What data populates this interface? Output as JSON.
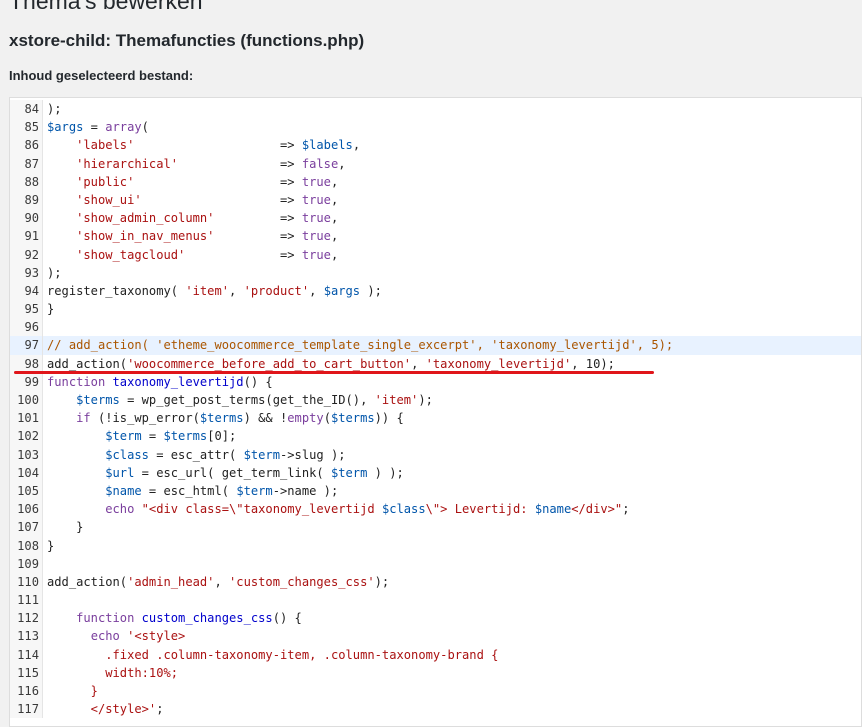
{
  "header": {
    "page_title": "Thema's bewerken",
    "file_title": "xstore-child: Themafuncties (functions.php)",
    "content_label": "Inhoud geselecteerd bestand:"
  },
  "editor": {
    "active_line": 97,
    "highlighted_line": 98,
    "lines": [
      {
        "num": "84",
        "segments": [
          {
            "t": ");",
            "c": "plain"
          }
        ]
      },
      {
        "num": "85",
        "segments": [
          {
            "t": "$args",
            "c": "var"
          },
          {
            "t": " = ",
            "c": "plain"
          },
          {
            "t": "array",
            "c": "kw"
          },
          {
            "t": "(",
            "c": "plain"
          }
        ]
      },
      {
        "num": "86",
        "segments": [
          {
            "t": "    'labels'",
            "c": "str"
          },
          {
            "t": "                    => ",
            "c": "plain"
          },
          {
            "t": "$labels",
            "c": "var"
          },
          {
            "t": ",",
            "c": "plain"
          }
        ]
      },
      {
        "num": "87",
        "segments": [
          {
            "t": "    'hierarchical'",
            "c": "str"
          },
          {
            "t": "              => ",
            "c": "plain"
          },
          {
            "t": "false",
            "c": "kw"
          },
          {
            "t": ",",
            "c": "plain"
          }
        ]
      },
      {
        "num": "88",
        "segments": [
          {
            "t": "    'public'",
            "c": "str"
          },
          {
            "t": "                    => ",
            "c": "plain"
          },
          {
            "t": "true",
            "c": "kw"
          },
          {
            "t": ",",
            "c": "plain"
          }
        ]
      },
      {
        "num": "89",
        "segments": [
          {
            "t": "    'show_ui'",
            "c": "str"
          },
          {
            "t": "                   => ",
            "c": "plain"
          },
          {
            "t": "true",
            "c": "kw"
          },
          {
            "t": ",",
            "c": "plain"
          }
        ]
      },
      {
        "num": "90",
        "segments": [
          {
            "t": "    'show_admin_column'",
            "c": "str"
          },
          {
            "t": "         => ",
            "c": "plain"
          },
          {
            "t": "true",
            "c": "kw"
          },
          {
            "t": ",",
            "c": "plain"
          }
        ]
      },
      {
        "num": "91",
        "segments": [
          {
            "t": "    'show_in_nav_menus'",
            "c": "str"
          },
          {
            "t": "         => ",
            "c": "plain"
          },
          {
            "t": "true",
            "c": "kw"
          },
          {
            "t": ",",
            "c": "plain"
          }
        ]
      },
      {
        "num": "92",
        "segments": [
          {
            "t": "    'show_tagcloud'",
            "c": "str"
          },
          {
            "t": "             => ",
            "c": "plain"
          },
          {
            "t": "true",
            "c": "kw"
          },
          {
            "t": ",",
            "c": "plain"
          }
        ]
      },
      {
        "num": "93",
        "segments": [
          {
            "t": ");",
            "c": "plain"
          }
        ]
      },
      {
        "num": "94",
        "segments": [
          {
            "t": "register_taxonomy( ",
            "c": "plain"
          },
          {
            "t": "'item'",
            "c": "str"
          },
          {
            "t": ", ",
            "c": "plain"
          },
          {
            "t": "'product'",
            "c": "str"
          },
          {
            "t": ", ",
            "c": "plain"
          },
          {
            "t": "$args",
            "c": "var"
          },
          {
            "t": " );",
            "c": "plain"
          }
        ]
      },
      {
        "num": "95",
        "segments": [
          {
            "t": "}",
            "c": "plain"
          }
        ]
      },
      {
        "num": "96",
        "segments": [
          {
            "t": "",
            "c": "plain"
          }
        ]
      },
      {
        "num": "97",
        "segments": [
          {
            "t": "// add_action( 'etheme_woocommerce_template_single_excerpt', 'taxonomy_levertijd', 5);",
            "c": "com"
          }
        ]
      },
      {
        "num": "98",
        "segments": [
          {
            "t": "add_action(",
            "c": "plain"
          },
          {
            "t": "'woocommerce_before_add_to_cart_button'",
            "c": "str"
          },
          {
            "t": ", ",
            "c": "plain"
          },
          {
            "t": "'taxonomy_levertijd'",
            "c": "str"
          },
          {
            "t": ", 10);",
            "c": "plain"
          }
        ]
      },
      {
        "num": "99",
        "segments": [
          {
            "t": "function",
            "c": "kw"
          },
          {
            "t": " ",
            "c": "plain"
          },
          {
            "t": "taxonomy_levertijd",
            "c": "fn"
          },
          {
            "t": "() {",
            "c": "plain"
          }
        ]
      },
      {
        "num": "100",
        "segments": [
          {
            "t": "    ",
            "c": "plain"
          },
          {
            "t": "$terms",
            "c": "var"
          },
          {
            "t": " = wp_get_post_terms(get_the_ID(), ",
            "c": "plain"
          },
          {
            "t": "'item'",
            "c": "str"
          },
          {
            "t": ");",
            "c": "plain"
          }
        ]
      },
      {
        "num": "101",
        "segments": [
          {
            "t": "    ",
            "c": "plain"
          },
          {
            "t": "if",
            "c": "kw"
          },
          {
            "t": " (!is_wp_error(",
            "c": "plain"
          },
          {
            "t": "$terms",
            "c": "var"
          },
          {
            "t": ") && !",
            "c": "plain"
          },
          {
            "t": "empty",
            "c": "kw"
          },
          {
            "t": "(",
            "c": "plain"
          },
          {
            "t": "$terms",
            "c": "var"
          },
          {
            "t": ")) {",
            "c": "plain"
          }
        ]
      },
      {
        "num": "102",
        "segments": [
          {
            "t": "        ",
            "c": "plain"
          },
          {
            "t": "$term",
            "c": "var"
          },
          {
            "t": " = ",
            "c": "plain"
          },
          {
            "t": "$terms",
            "c": "var"
          },
          {
            "t": "[0];",
            "c": "plain"
          }
        ]
      },
      {
        "num": "103",
        "segments": [
          {
            "t": "        ",
            "c": "plain"
          },
          {
            "t": "$class",
            "c": "var"
          },
          {
            "t": " = esc_attr( ",
            "c": "plain"
          },
          {
            "t": "$term",
            "c": "var"
          },
          {
            "t": "->slug );",
            "c": "plain"
          }
        ]
      },
      {
        "num": "104",
        "segments": [
          {
            "t": "        ",
            "c": "plain"
          },
          {
            "t": "$url",
            "c": "var"
          },
          {
            "t": " = esc_url( get_term_link( ",
            "c": "plain"
          },
          {
            "t": "$term",
            "c": "var"
          },
          {
            "t": " ) );",
            "c": "plain"
          }
        ]
      },
      {
        "num": "105",
        "segments": [
          {
            "t": "        ",
            "c": "plain"
          },
          {
            "t": "$name",
            "c": "var"
          },
          {
            "t": " = esc_html( ",
            "c": "plain"
          },
          {
            "t": "$term",
            "c": "var"
          },
          {
            "t": "->name );",
            "c": "plain"
          }
        ]
      },
      {
        "num": "106",
        "segments": [
          {
            "t": "        ",
            "c": "plain"
          },
          {
            "t": "echo",
            "c": "kw"
          },
          {
            "t": " ",
            "c": "plain"
          },
          {
            "t": "\"<div class=\\\"taxonomy_levertijd ",
            "c": "str"
          },
          {
            "t": "$class",
            "c": "var"
          },
          {
            "t": "\\\"> Levertijd: ",
            "c": "str"
          },
          {
            "t": "$name",
            "c": "var"
          },
          {
            "t": "</div>\"",
            "c": "str"
          },
          {
            "t": ";",
            "c": "plain"
          }
        ]
      },
      {
        "num": "107",
        "segments": [
          {
            "t": "    }",
            "c": "plain"
          }
        ]
      },
      {
        "num": "108",
        "segments": [
          {
            "t": "}",
            "c": "plain"
          }
        ]
      },
      {
        "num": "109",
        "segments": [
          {
            "t": "",
            "c": "plain"
          }
        ]
      },
      {
        "num": "110",
        "segments": [
          {
            "t": "add_action(",
            "c": "plain"
          },
          {
            "t": "'admin_head'",
            "c": "str"
          },
          {
            "t": ", ",
            "c": "plain"
          },
          {
            "t": "'custom_changes_css'",
            "c": "str"
          },
          {
            "t": ");",
            "c": "plain"
          }
        ]
      },
      {
        "num": "111",
        "segments": [
          {
            "t": "",
            "c": "plain"
          }
        ]
      },
      {
        "num": "112",
        "segments": [
          {
            "t": "    ",
            "c": "plain"
          },
          {
            "t": "function",
            "c": "kw"
          },
          {
            "t": " ",
            "c": "plain"
          },
          {
            "t": "custom_changes_css",
            "c": "fn"
          },
          {
            "t": "() {",
            "c": "plain"
          }
        ]
      },
      {
        "num": "113",
        "segments": [
          {
            "t": "      ",
            "c": "plain"
          },
          {
            "t": "echo",
            "c": "kw"
          },
          {
            "t": " ",
            "c": "plain"
          },
          {
            "t": "'<style>",
            "c": "str"
          }
        ]
      },
      {
        "num": "114",
        "segments": [
          {
            "t": "        .fixed .column-taxonomy-item, .column-taxonomy-brand {",
            "c": "str"
          }
        ]
      },
      {
        "num": "115",
        "segments": [
          {
            "t": "        width:10%;",
            "c": "str"
          }
        ]
      },
      {
        "num": "116",
        "segments": [
          {
            "t": "      }",
            "c": "str"
          }
        ]
      },
      {
        "num": "117",
        "segments": [
          {
            "t": "      </style>'",
            "c": "str"
          },
          {
            "t": ";",
            "c": "plain"
          }
        ]
      }
    ]
  }
}
